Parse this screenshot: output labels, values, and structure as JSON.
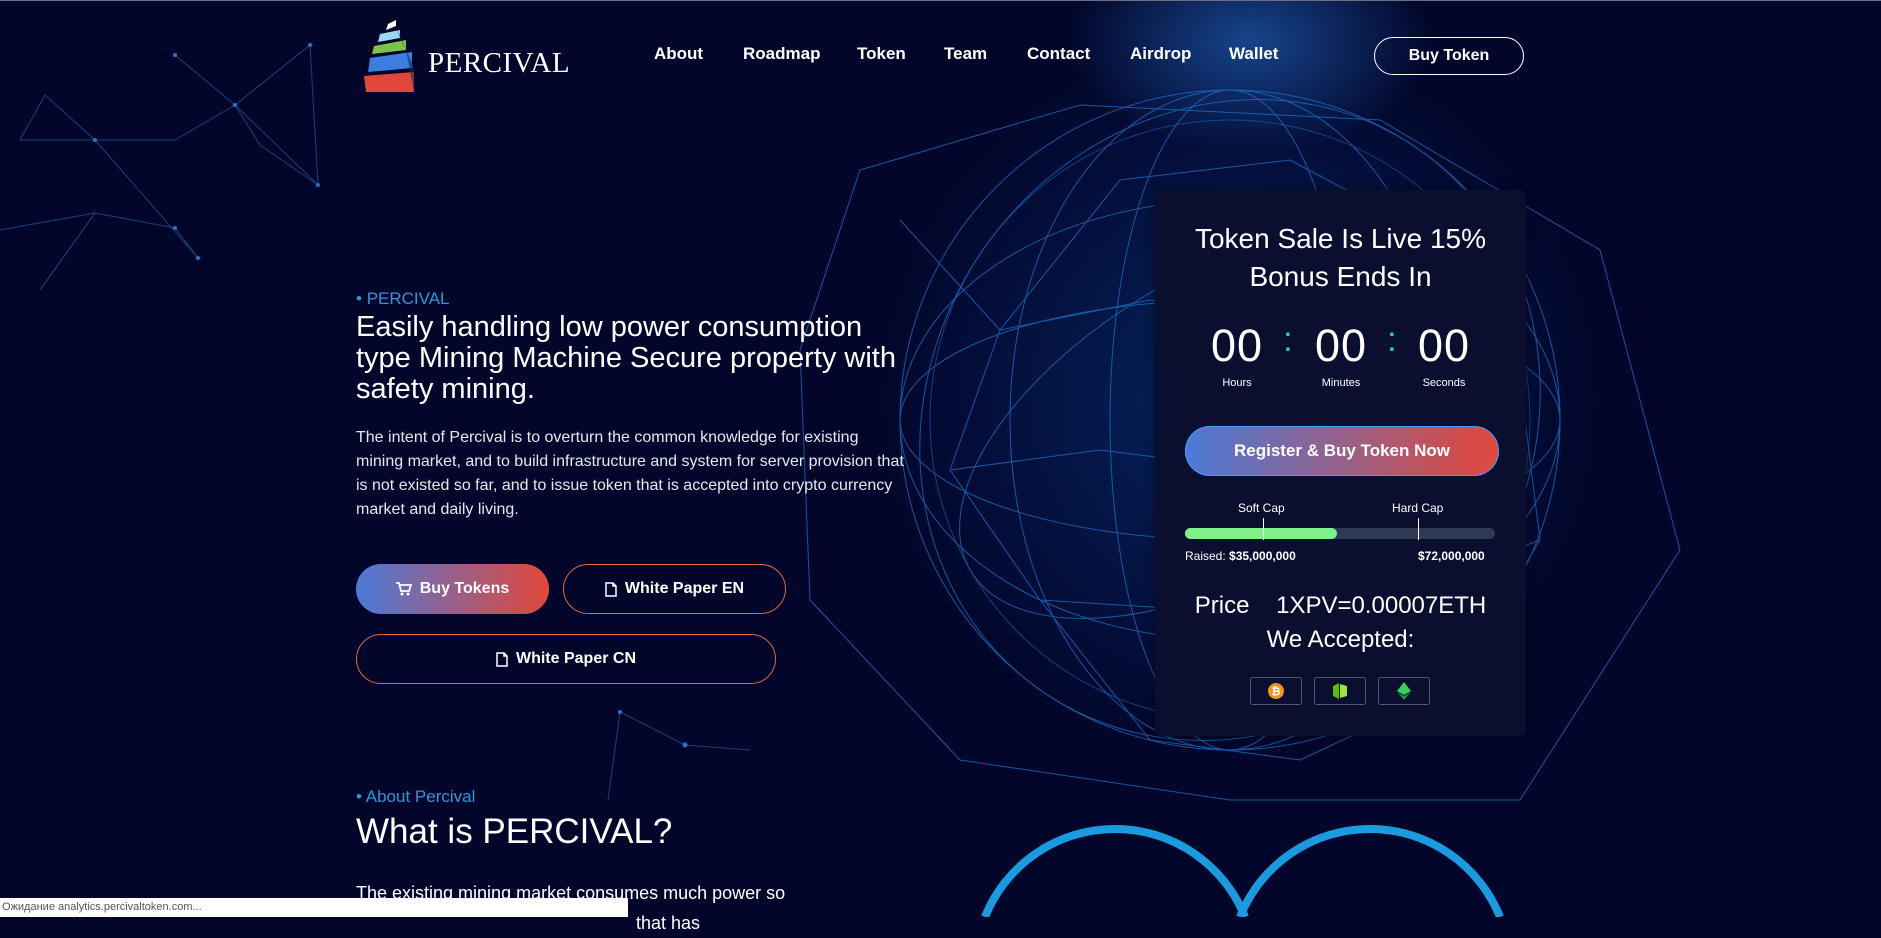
{
  "brand": {
    "name": "PERCIVAL"
  },
  "nav": {
    "items": [
      "About",
      "Roadmap",
      "Token",
      "Team",
      "Contact",
      "Airdrop",
      "Wallet"
    ],
    "cta": "Buy Token"
  },
  "hero": {
    "kicker": "PERCIVAL",
    "title": "Easily handling low power consumption type Mining Machine Secure property with safety mining.",
    "description": "The intent of Percival is to overturn the common knowledge for existing mining market, and to build infrastructure and system for server provision that is not existed so far, and to issue token that is accepted into crypto currency market and daily living.",
    "buy_label": "Buy Tokens",
    "wp_en_label": "White Paper EN",
    "wp_cn_label": "White Paper CN"
  },
  "about": {
    "kicker": "About Percival",
    "title": "What is PERCIVAL?",
    "text_line1": "The existing mining market consumes much power so",
    "text_line2": "that has"
  },
  "sale": {
    "title_line1": "Token Sale Is Live 15%",
    "title_line2": "Bonus Ends In",
    "hours": "00",
    "minutes": "00",
    "seconds": "00",
    "hours_label": "Hours",
    "minutes_label": "Minutes",
    "seconds_label": "Seconds",
    "register_label": "Register & Buy Token Now",
    "soft_cap_label": "Soft Cap",
    "hard_cap_label": "Hard Cap",
    "raised_label": "Raised:",
    "raised_value": "$35,000,000",
    "hard_cap_value": "$72,000,000",
    "progress_fraction": 0.49,
    "price_label": "Price",
    "price_value": "1XPV=0.00007ETH",
    "accepted_label": "We Accepted:",
    "coins": [
      "bitcoin-icon",
      "neo-icon",
      "ethereum-icon"
    ]
  },
  "status_bar": {
    "text": "Ожидание analytics.percivaltoken.com..."
  },
  "colors": {
    "background": "#02062a",
    "accent_blue": "#2f97d8",
    "gradient_start": "#4b7ad8",
    "gradient_end": "#e2473a",
    "progress": "#7ef28a"
  }
}
